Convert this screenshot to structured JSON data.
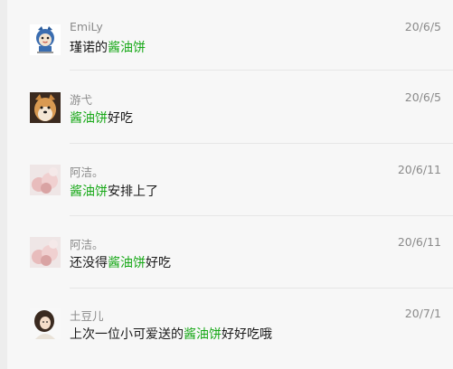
{
  "comments": [
    {
      "name": "EmiLy",
      "date": "20/6/5",
      "pre": "瑾诺的",
      "keyword": "酱油饼",
      "post": "",
      "avatar": "cartoon-avatar"
    },
    {
      "name": "游弋",
      "date": "20/6/5",
      "pre": "",
      "keyword": "酱油饼",
      "post": "好吃",
      "avatar": "shiba-dog-avatar"
    },
    {
      "name": "阿洁。",
      "date": "20/6/11",
      "pre": "",
      "keyword": "酱油饼",
      "post": "安排上了",
      "avatar": "pink-flower-avatar"
    },
    {
      "name": "阿洁。",
      "date": "20/6/11",
      "pre": "还没得",
      "keyword": "酱油饼",
      "post": "好吃",
      "avatar": "pink-flower-avatar"
    },
    {
      "name": "土豆儿",
      "date": "20/7/1",
      "pre": "上次一位小可爱送的",
      "keyword": "酱油饼",
      "post": "好好吃哦",
      "avatar": "girl-avatar"
    }
  ],
  "colors": {
    "keyword": "#17a817",
    "meta": "#8a8a8a",
    "text": "#1a1a1a",
    "background": "#f7f7f7"
  }
}
